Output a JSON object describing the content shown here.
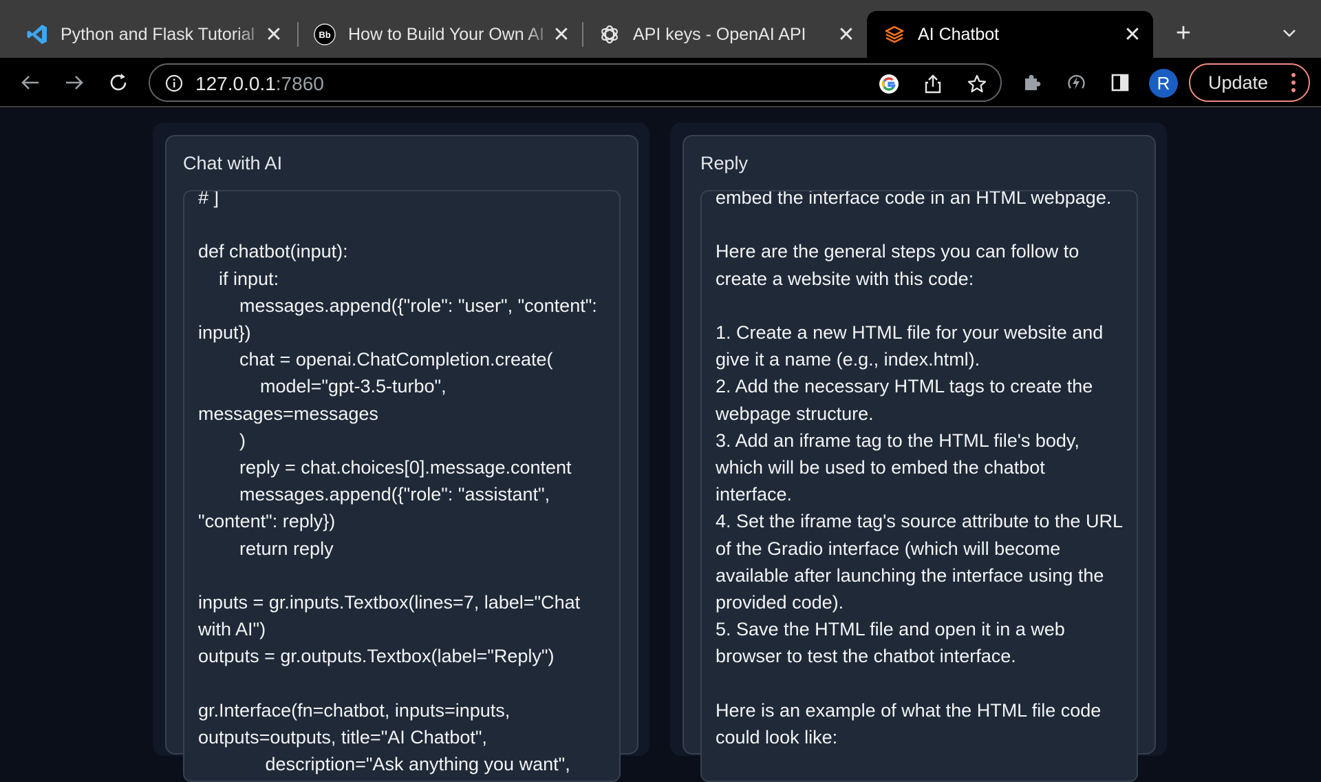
{
  "browser": {
    "tabs": [
      {
        "title": "Python and Flask Tutorial",
        "favicon": "vscode-icon"
      },
      {
        "title": "How to Build Your Own AI",
        "favicon": "bb-icon"
      },
      {
        "title": "API keys - OpenAI API",
        "favicon": "openai-icon"
      },
      {
        "title": "AI Chatbot",
        "favicon": "gradio-icon",
        "active": true
      }
    ],
    "new_tab": "+",
    "bb_badge": "Bb",
    "url_host": "127.0.0.1",
    "url_port": ":7860",
    "avatar_letter": "R",
    "update_label": "Update"
  },
  "app": {
    "input_panel": {
      "label": "Chat with AI",
      "text": "# ]\n\ndef chatbot(input):\n    if input:\n        messages.append({\"role\": \"user\", \"content\": input})\n        chat = openai.ChatCompletion.create(\n            model=\"gpt-3.5-turbo\", messages=messages\n        )\n        reply = chat.choices[0].message.content\n        messages.append({\"role\": \"assistant\", \"content\": reply})\n        return reply\n\ninputs = gr.inputs.Textbox(lines=7, label=\"Chat with AI\")\noutputs = gr.outputs.Textbox(label=\"Reply\")\n\ngr.Interface(fn=chatbot, inputs=inputs, outputs=outputs, title=\"AI Chatbot\",\n             description=\"Ask anything you want\","
    },
    "output_panel": {
      "label": "Reply",
      "text": "embed the interface code in an HTML webpage.\n\nHere are the general steps you can follow to create a website with this code:\n\n1. Create a new HTML file for your website and give it a name (e.g., index.html).\n2. Add the necessary HTML tags to create the webpage structure.\n3. Add an iframe tag to the HTML file's body, which will be used to embed the chatbot interface.\n4. Set the iframe tag's source attribute to the URL of the Gradio interface (which will become available after launching the interface using the provided code).\n5. Save the HTML file and open it in a web browser to test the chatbot interface.\n\nHere is an example of what the HTML file code could look like:"
    }
  },
  "colors": {
    "page_bg": "#0b0f19",
    "panel_bg": "#1f2937",
    "border": "#374151",
    "update_border": "#f28b82",
    "avatar_bg": "#1a5ec2",
    "gradio_orange": "#f97316",
    "vscode_blue": "#3ea6f0"
  }
}
